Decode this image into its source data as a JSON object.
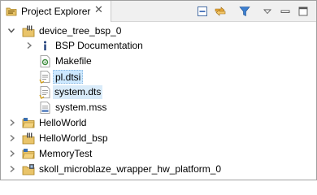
{
  "view": {
    "title": "Project Explorer",
    "tab_icon": "project-explorer-icon",
    "close_glyph": "✕",
    "toolbar": [
      {
        "name": "collapse-all-icon"
      },
      {
        "name": "link-with-editor-icon"
      },
      {
        "name": "filter-icon"
      },
      {
        "name": "view-menu-icon"
      },
      {
        "name": "minimize-icon"
      },
      {
        "name": "maximize-icon"
      }
    ]
  },
  "tree": {
    "items": [
      {
        "label": "device_tree_bsp_0",
        "level": 0,
        "expanded": true,
        "icon": "bsp-project-icon"
      },
      {
        "label": "BSP Documentation",
        "level": 1,
        "expanded": false,
        "icon": "info-icon"
      },
      {
        "label": "Makefile",
        "level": 1,
        "icon": "makefile-icon"
      },
      {
        "label": "pl.dtsi",
        "level": 1,
        "icon": "file-icon",
        "selected": true
      },
      {
        "label": "system.dts",
        "level": 1,
        "icon": "file-icon",
        "selected": true
      },
      {
        "label": "system.mss",
        "level": 1,
        "icon": "mss-file-icon"
      },
      {
        "label": "HelloWorld",
        "level": 0,
        "expanded": false,
        "icon": "c-project-icon"
      },
      {
        "label": "HelloWorld_bsp",
        "level": 0,
        "expanded": false,
        "icon": "bsp-project-icon"
      },
      {
        "label": "MemoryTest",
        "level": 0,
        "expanded": false,
        "icon": "c-project-icon"
      },
      {
        "label": "skoll_microblaze_wrapper_hw_platform_0",
        "level": 0,
        "expanded": false,
        "icon": "hw-platform-icon"
      }
    ]
  }
}
